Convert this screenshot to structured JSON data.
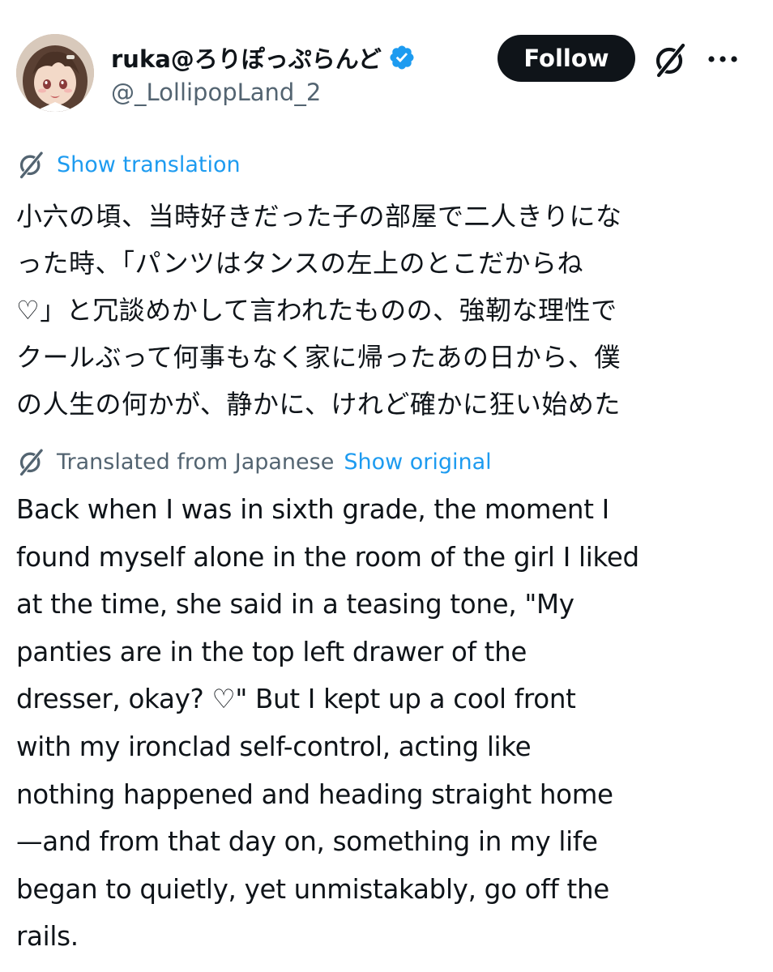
{
  "post": {
    "author": {
      "display_name": "ruka@ろりぽっぷらんど",
      "handle": "@_LollipopLand_2",
      "verified": true,
      "avatar_icon": "avatar-image"
    },
    "actions": {
      "follow_label": "Follow",
      "grok_icon": "grok-icon",
      "more_icon": "more-horizontal-icon"
    },
    "show_translation_label": "Show translation",
    "original_text_lines": [
      "小六の頃、当時好きだった子の部屋で二人きりにな",
      "った時、「パンツはタンスの左上のとこだからね",
      "♡」と冗談めかして言われたものの、強靭な理性で",
      "クールぶって何事もなく家に帰ったあの日から、僕",
      "の人生の何かが、静かに、けれど確かに狂い始めた"
    ],
    "translated_from_label": "Translated from Japanese",
    "show_original_label": "Show original",
    "translated_text_lines": [
      "Back when I was in sixth grade, the moment I",
      "found myself alone in the room of the girl I liked",
      "at the time, she said in a teasing tone, \"My",
      "panties are in the top left drawer of the",
      "dresser, okay? ♡\" But I kept up a cool front",
      "with my ironclad self-control, acting like",
      "nothing happened and heading straight home",
      "—and from that day on, something in my life",
      "began to quietly, yet unmistakably, go off the",
      "rails."
    ],
    "colors": {
      "text": "#0f1419",
      "secondary": "#536471",
      "link": "#1d9bf0",
      "follow_bg": "#0f1419",
      "verified": "#1d9bf0"
    }
  }
}
